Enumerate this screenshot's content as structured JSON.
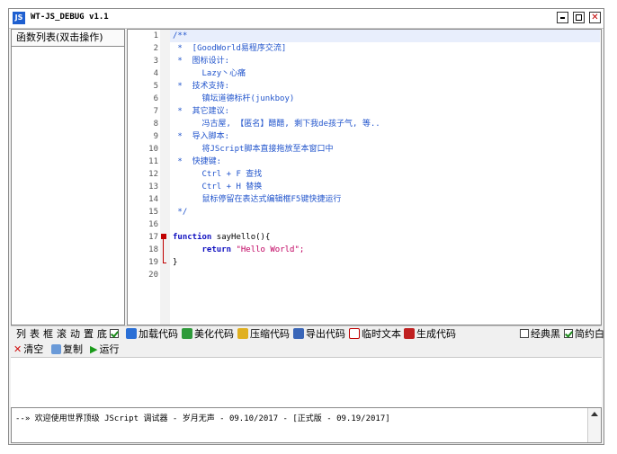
{
  "window": {
    "app_icon": "JS",
    "title": "WT-JS_DEBUG v1.1"
  },
  "left_panel": {
    "header": "函数列表(双击操作)"
  },
  "editor": {
    "lines": [
      {
        "n": "1",
        "text": "/**",
        "cls": "cm"
      },
      {
        "n": "2",
        "text": " *  [GoodWorld易程序交流]",
        "cls": "cm"
      },
      {
        "n": "3",
        "text": " *  图标设计:",
        "cls": "cm"
      },
      {
        "n": "4",
        "text": "      Lazy丶心痛",
        "cls": "cm"
      },
      {
        "n": "5",
        "text": " *  技术支持:",
        "cls": "cm"
      },
      {
        "n": "6",
        "text": "      镇坛道德标杆(junkboy)",
        "cls": "cm"
      },
      {
        "n": "7",
        "text": " *  其它建议:",
        "cls": "cm"
      },
      {
        "n": "8",
        "text": "      冯古屋, 【匿名】醋醋, 剩下我de孩子气, 等..",
        "cls": "cm"
      },
      {
        "n": "9",
        "text": " *  导入脚本:",
        "cls": "cm"
      },
      {
        "n": "10",
        "text": "      将JScript脚本直接拖放至本窗口中",
        "cls": "cm"
      },
      {
        "n": "11",
        "text": " *  快捷键:",
        "cls": "cm"
      },
      {
        "n": "12",
        "text": "      Ctrl + F 查找",
        "cls": "cm"
      },
      {
        "n": "13",
        "text": "      Ctrl + H 替换",
        "cls": "cm"
      },
      {
        "n": "14",
        "text": "      鼠标停留在表达式编辑框F5键快捷运行",
        "cls": "cm"
      },
      {
        "n": "15",
        "text": " */",
        "cls": "cm"
      },
      {
        "n": "16",
        "text": "",
        "cls": ""
      },
      {
        "n": "17",
        "text": "",
        "cls": ""
      },
      {
        "n": "18",
        "text": "",
        "cls": ""
      },
      {
        "n": "19",
        "text": "}",
        "cls": "fn"
      },
      {
        "n": "20",
        "text": "",
        "cls": ""
      }
    ],
    "func_keyword": "function",
    "func_name": " sayHello(){",
    "return_keyword": "return",
    "return_string": " \"Hello World\";"
  },
  "toolbar": {
    "side_buttons": [
      "列",
      "表",
      "框",
      "滚",
      "动",
      "置",
      "底"
    ],
    "load": "加载代码",
    "beautify": "美化代码",
    "compress": "压缩代码",
    "export": "导出代码",
    "temp_text": "临时文本",
    "generate": "生成代码",
    "classic_black": "经典黑",
    "simple_white": "简约白"
  },
  "toolbar2": {
    "clear": "清空",
    "copy": "复制",
    "run": "运行"
  },
  "console": {
    "message": "--» 欢迎使用世界顶级 JScript 调试器 - 岁月无声 - 09.10/2017 - [正式版 - 09.19/2017]"
  },
  "colors": {
    "comment": "#2255cc",
    "keyword": "#1010c0",
    "string": "#c00060",
    "fold": "#c00000"
  }
}
